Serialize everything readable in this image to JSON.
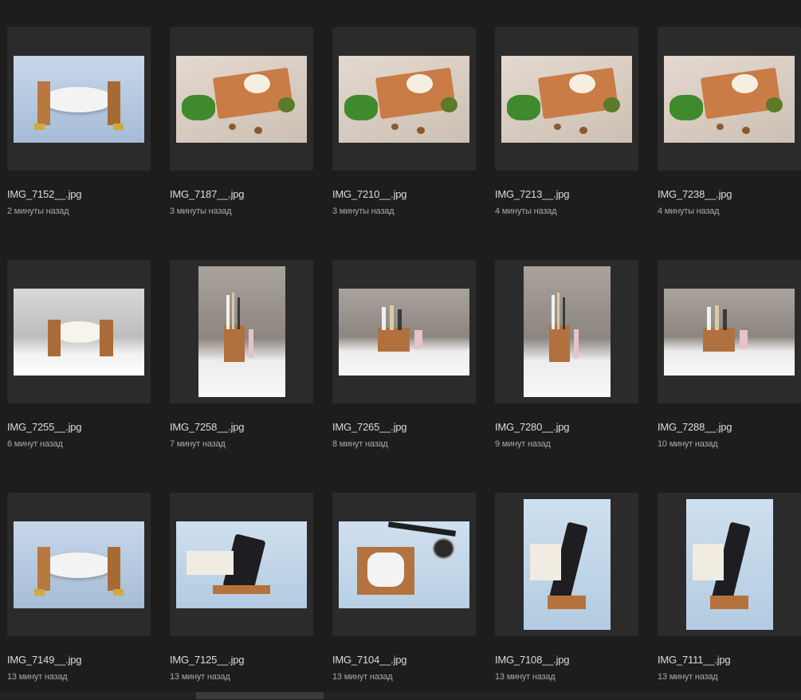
{
  "files": [
    {
      "name": "IMG_7152__.jpg",
      "time": "2 минуты назад",
      "orientation": "landscape",
      "scene": "soap-dish-blue"
    },
    {
      "name": "IMG_7187__.jpg",
      "time": "3 минуты назад",
      "orientation": "landscape",
      "scene": "cheese-board"
    },
    {
      "name": "IMG_7210__.jpg",
      "time": "3 минуты назад",
      "orientation": "landscape",
      "scene": "cheese-board"
    },
    {
      "name": "IMG_7213__.jpg",
      "time": "4 минуты назад",
      "orientation": "landscape",
      "scene": "cheese-board"
    },
    {
      "name": "IMG_7238__.jpg",
      "time": "4 минуты назад",
      "orientation": "landscape",
      "scene": "cheese-board"
    },
    {
      "name": "IMG_7255__.jpg",
      "time": "6 минут назад",
      "orientation": "landscape",
      "scene": "soap-dish-bath"
    },
    {
      "name": "IMG_7258__.jpg",
      "time": "7 минут назад",
      "orientation": "portrait",
      "scene": "toothbrush-holder"
    },
    {
      "name": "IMG_7265__.jpg",
      "time": "8 минут назад",
      "orientation": "landscape",
      "scene": "toothbrush-holder"
    },
    {
      "name": "IMG_7280__.jpg",
      "time": "9 минут назад",
      "orientation": "portrait",
      "scene": "toothbrush-holder"
    },
    {
      "name": "IMG_7288__.jpg",
      "time": "10 минут назад",
      "orientation": "landscape",
      "scene": "toothbrush-holder"
    },
    {
      "name": "IMG_7149__.jpg",
      "time": "13 минут назад",
      "orientation": "landscape",
      "scene": "soap-dish-blue"
    },
    {
      "name": "IMG_7125__.jpg",
      "time": "13 минут назад",
      "orientation": "landscape",
      "scene": "phone-stand"
    },
    {
      "name": "IMG_7104__.jpg",
      "time": "13 минут назад",
      "orientation": "landscape",
      "scene": "earbuds-tray"
    },
    {
      "name": "IMG_7108__.jpg",
      "time": "13 минут назад",
      "orientation": "portrait",
      "scene": "phone-stand"
    },
    {
      "name": "IMG_7111__.jpg",
      "time": "13 минут назад",
      "orientation": "portrait",
      "scene": "phone-stand"
    }
  ]
}
